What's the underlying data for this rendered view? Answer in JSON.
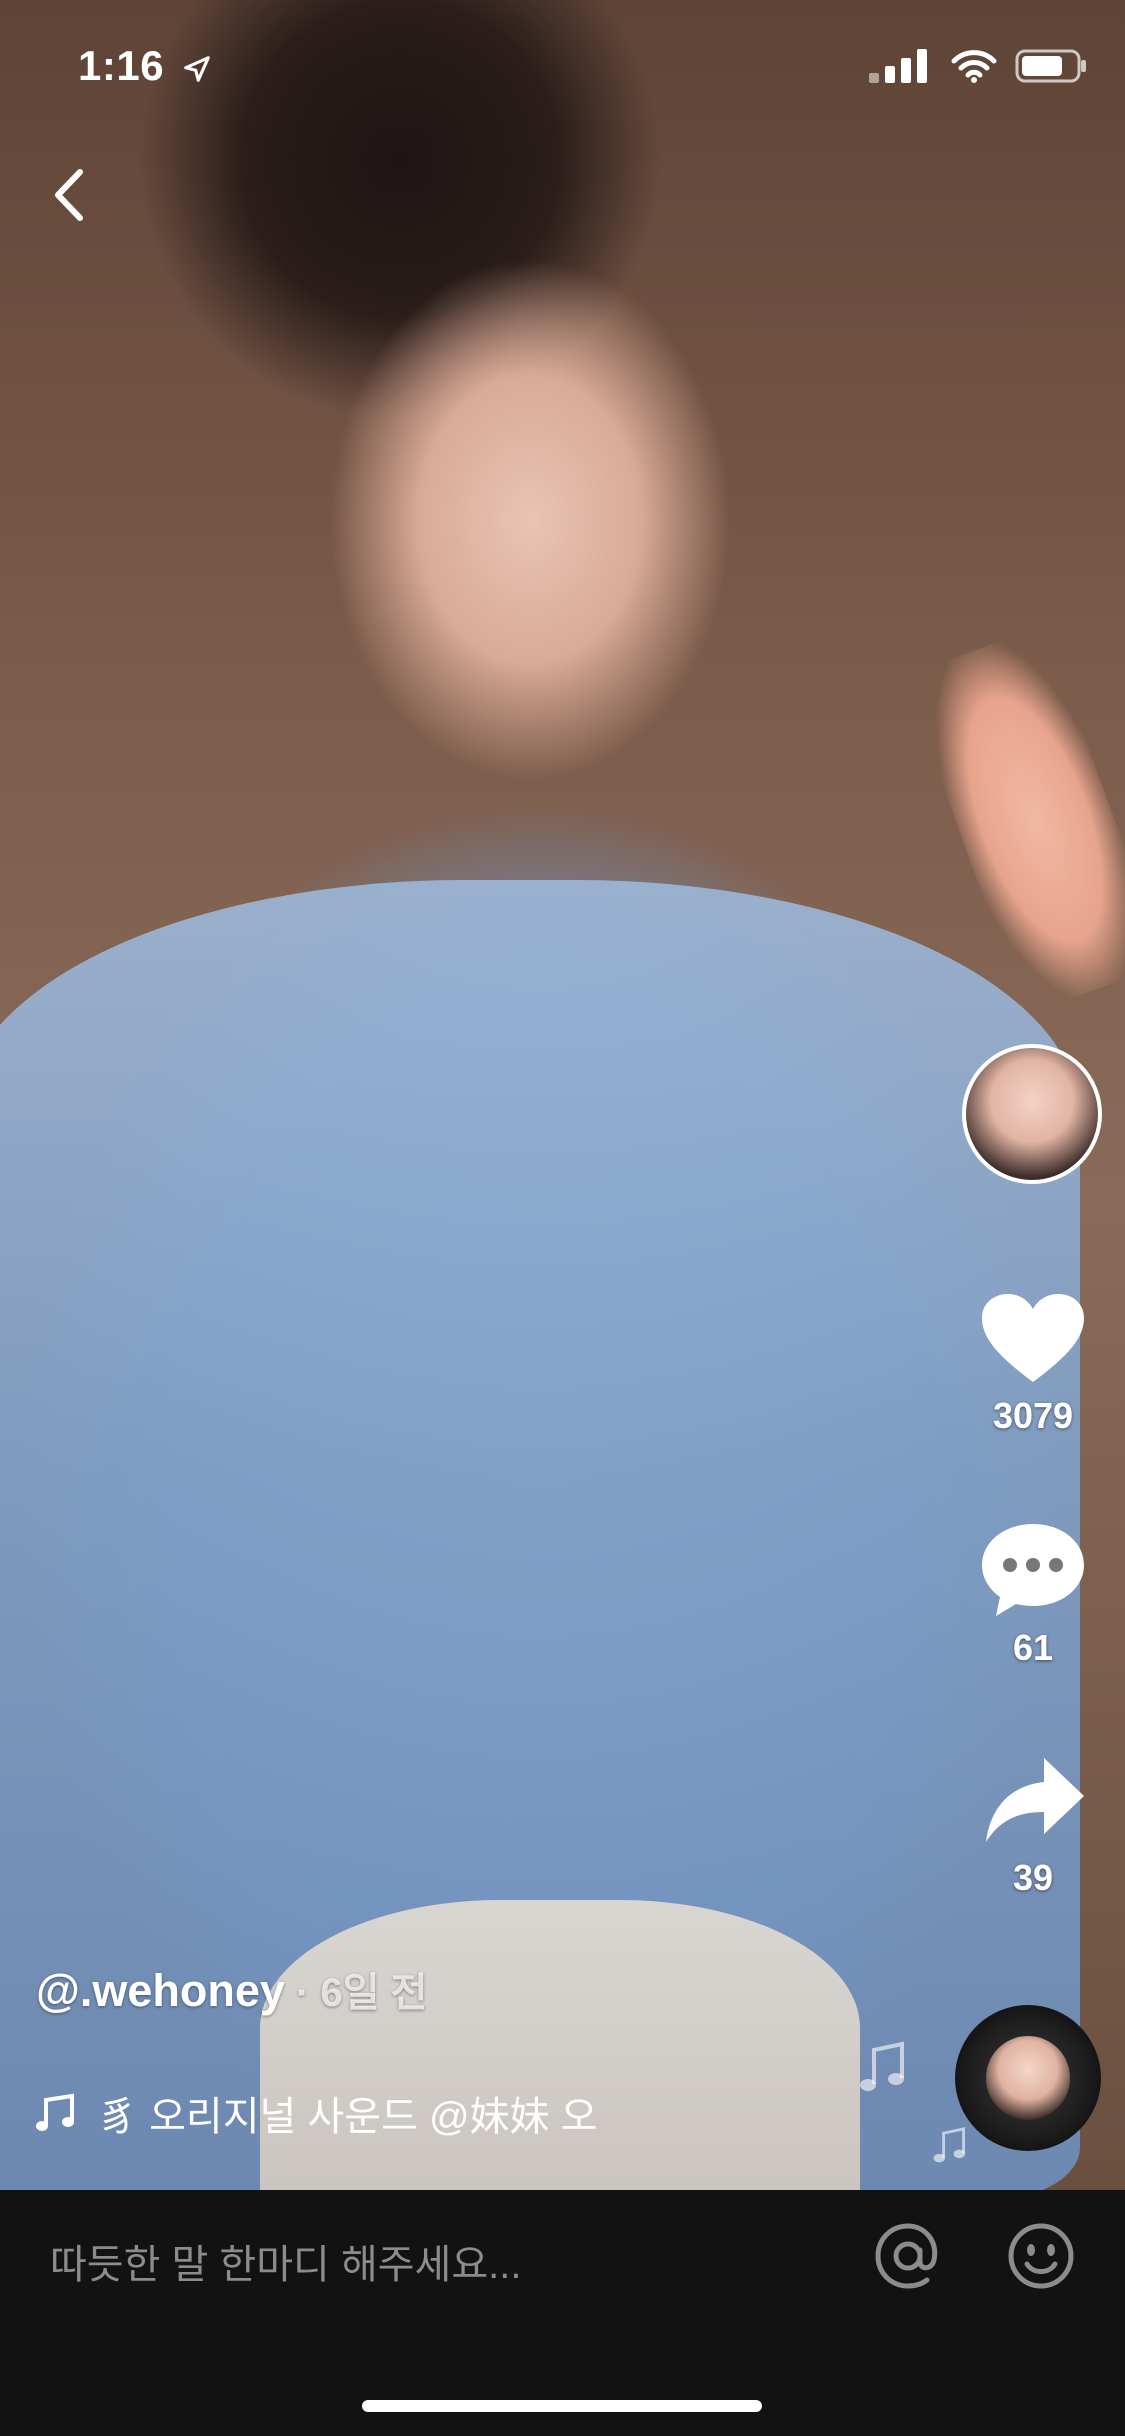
{
  "status_bar": {
    "time": "1:16"
  },
  "creator": {
    "username": "@.wehoney",
    "separator": " · ",
    "posted": "6일 전"
  },
  "actions": {
    "likes": "3079",
    "comments": "61",
    "shares": "39"
  },
  "music": {
    "label": "⾘ 오리지널 사운드    @妹妹 오"
  },
  "comment_bar": {
    "placeholder": "따듯한 말 한마디 해주세요..."
  },
  "icons": [
    "location-arrow-icon",
    "signal-icon",
    "wifi-icon",
    "battery-icon",
    "back-chevron-icon",
    "heart-icon",
    "comment-icon",
    "share-icon",
    "music-note-icon",
    "at-icon",
    "emoji-icon"
  ]
}
